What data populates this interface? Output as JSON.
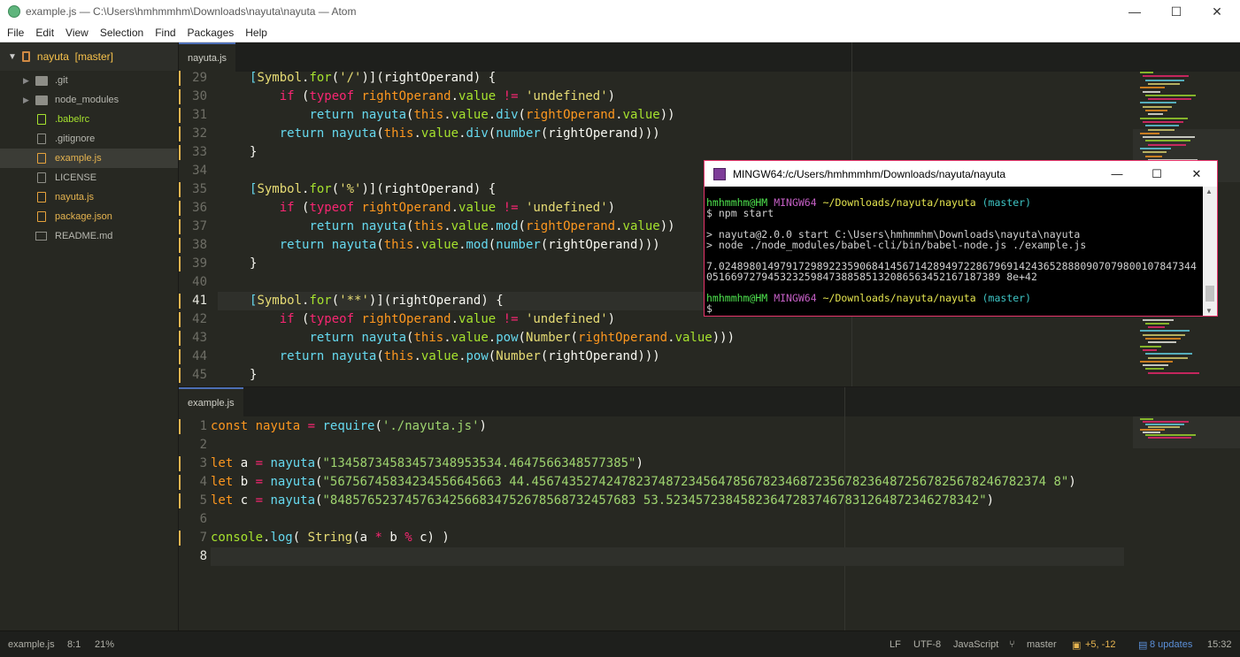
{
  "window": {
    "title": "example.js — C:\\Users\\hmhmmhm\\Downloads\\nayuta\\nayuta — Atom",
    "minimize": "—",
    "maximize": "☐",
    "close": "✕"
  },
  "menu": [
    "File",
    "Edit",
    "View",
    "Selection",
    "Find",
    "Packages",
    "Help"
  ],
  "tree": {
    "root_label": "nayuta",
    "root_branch": "[master]",
    "items": [
      {
        "name": ".git",
        "type": "folder"
      },
      {
        "name": "node_modules",
        "type": "folder"
      },
      {
        "name": ".babelrc",
        "type": "file",
        "status": "added"
      },
      {
        "name": ".gitignore",
        "type": "file"
      },
      {
        "name": "example.js",
        "type": "file",
        "status": "modified",
        "selected": true
      },
      {
        "name": "LICENSE",
        "type": "file"
      },
      {
        "name": "nayuta.js",
        "type": "file",
        "status": "modified"
      },
      {
        "name": "package.json",
        "type": "file",
        "status": "modified"
      },
      {
        "name": "README.md",
        "type": "book"
      }
    ]
  },
  "top_pane": {
    "tab": "nayuta.js",
    "line_numbers": [
      "29",
      "30",
      "31",
      "32",
      "33",
      "34",
      "35",
      "36",
      "37",
      "38",
      "39",
      "40",
      "41",
      "42",
      "43",
      "44",
      "45"
    ]
  },
  "bottom_pane": {
    "tab": "example.js",
    "line_numbers": [
      "1",
      "2",
      "3",
      "4",
      "5",
      "6",
      "7",
      "8"
    ]
  },
  "terminal": {
    "title": "MINGW64:/c/Users/hmhmmhm/Downloads/nayuta/nayuta",
    "prompt_user": "hmhmmhm@HM",
    "prompt_shell": "MINGW64",
    "prompt_path": "~/Downloads/nayuta/nayuta",
    "prompt_branch": "(master)",
    "cmd": "$ npm start",
    "out1": "> nayuta@2.0.0 start C:\\Users\\hmhmmhm\\Downloads\\nayuta\\nayuta",
    "out2": "> node ./node_modules/babel-cli/bin/babel-node.js ./example.js",
    "result1": "7.024898014979172989223590684145671428949722867969142436528880907079800107847344",
    "result2": "051669727945323259847388585132086563452167187389 8e+42",
    "dollar": "$"
  },
  "status": {
    "file": "example.js",
    "cursor": "8:1",
    "percent": "21%",
    "line_ending": "LF",
    "encoding": "UTF-8",
    "grammar": "JavaScript",
    "branch": "master",
    "diff": "+5, -12",
    "updates": "8 updates",
    "time": "15:32"
  }
}
